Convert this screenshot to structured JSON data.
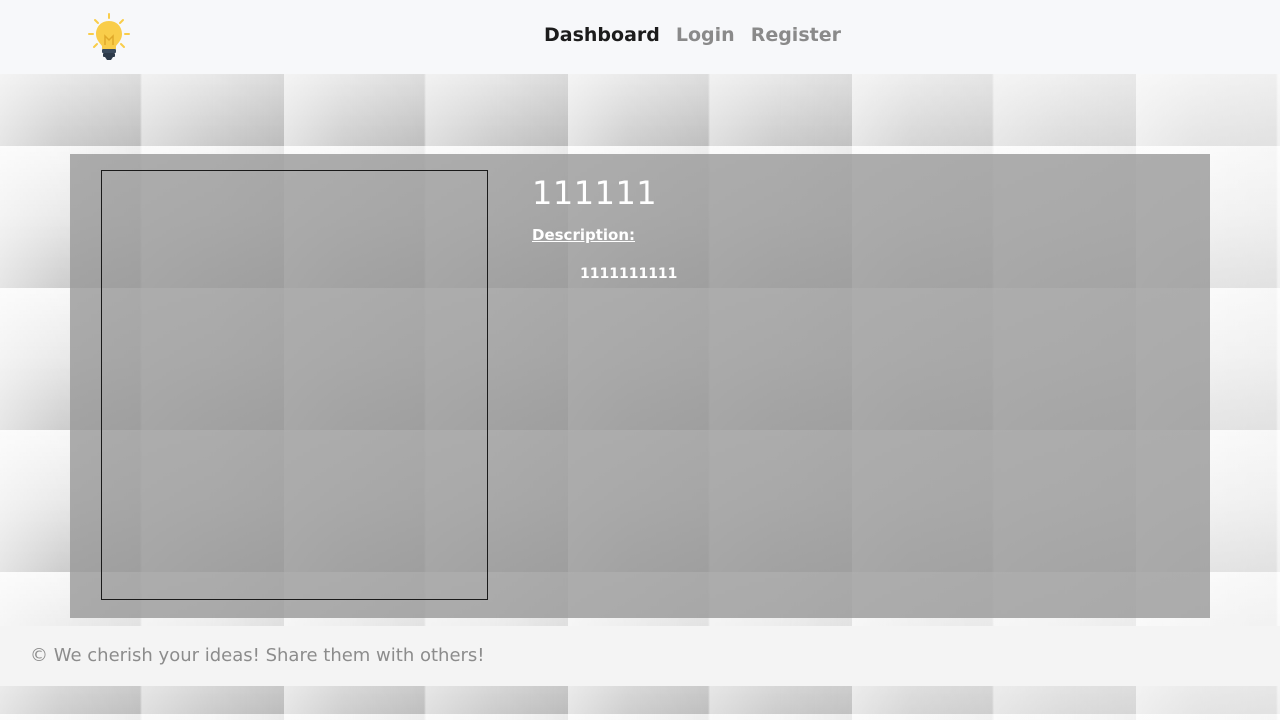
{
  "nav": {
    "logo_icon": "lightbulb-icon",
    "links": [
      {
        "label": "Dashboard",
        "active": true
      },
      {
        "label": "Login",
        "active": false
      },
      {
        "label": "Register",
        "active": false
      }
    ]
  },
  "idea": {
    "title": "111111",
    "description_label": "Description:",
    "description": "1111111111"
  },
  "footer": {
    "text": "© We cherish your ideas! Share them with others!"
  },
  "colors": {
    "nav_bg": "#f7f8fa",
    "active_link": "#1c1c1c",
    "inactive_link": "#8a8a8a",
    "card_bg": "#a5a5a5",
    "bulb": "#f9cd4a",
    "footer_text": "#8c8c8c"
  }
}
